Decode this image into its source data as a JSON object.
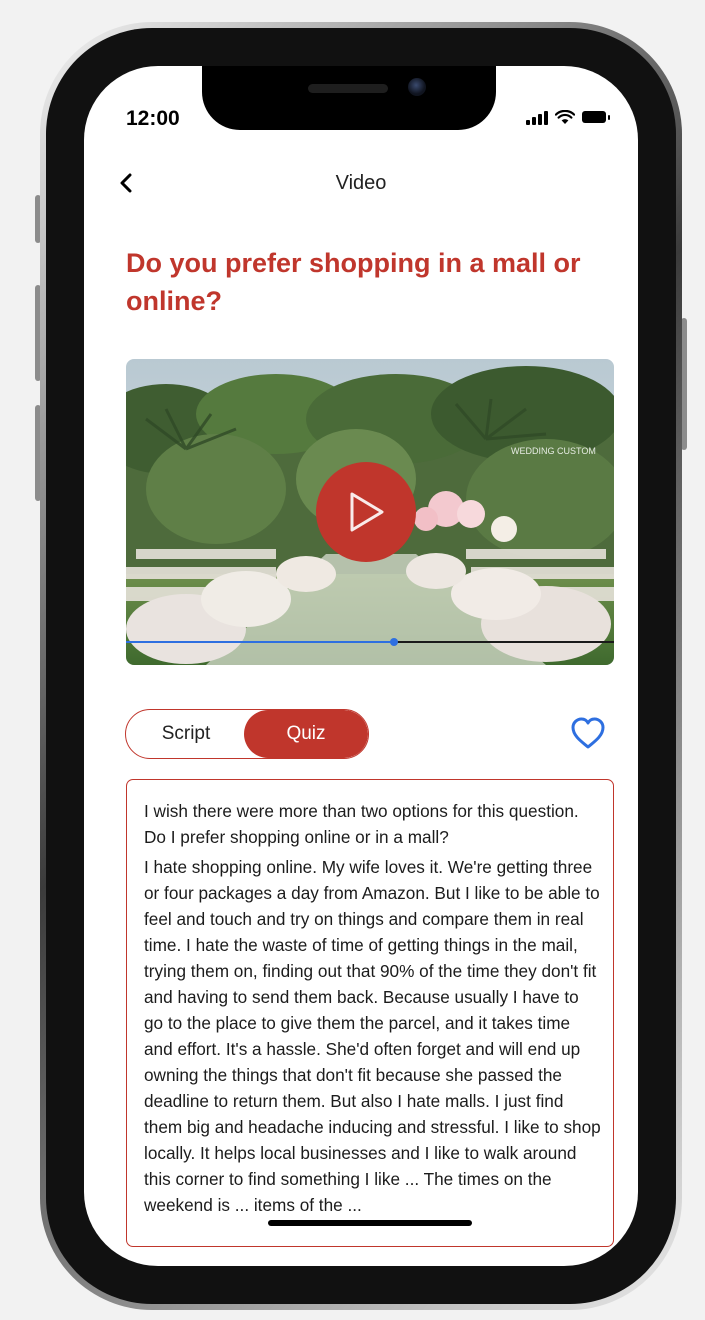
{
  "status_bar": {
    "time": "12:00"
  },
  "nav": {
    "title": "Video"
  },
  "page": {
    "title": "Do you prefer shopping in a mall or online?"
  },
  "video": {
    "watermark": "WEDDING CUSTOM",
    "progress_fraction": 0.55
  },
  "tabs": [
    {
      "label": "Script",
      "active": false
    },
    {
      "label": "Quiz",
      "active": true
    }
  ],
  "script": {
    "paragraphs": [
      "I wish there were more than two options for this question. Do I prefer shopping online or in a mall?",
      "I hate shopping online. My wife loves it. We're getting three or four packages a day from Amazon. But I like to be able to feel and touch and try on things and compare them in real time. I hate the waste of time of getting things in the mail, trying them on, finding out that 90% of the time they don't fit and having to send them back. Because usually I have to go to the place to give them the parcel, and it takes time and effort. It's a hassle. She'd often forget and will end up owning the things that don't fit because she passed the deadline to return them. But also I hate malls. I just find them big and headache inducing and stressful. I like to shop locally. It helps local businesses and I like to walk around this corner to find something I like ... The times on the weekend is ... items of the ..."
    ]
  },
  "colors": {
    "accent": "#c0362c",
    "link_blue": "#2e6fe0"
  },
  "icons": {
    "back": "chevron-left-icon",
    "favorite": "heart-outline-icon",
    "play": "play-icon"
  }
}
